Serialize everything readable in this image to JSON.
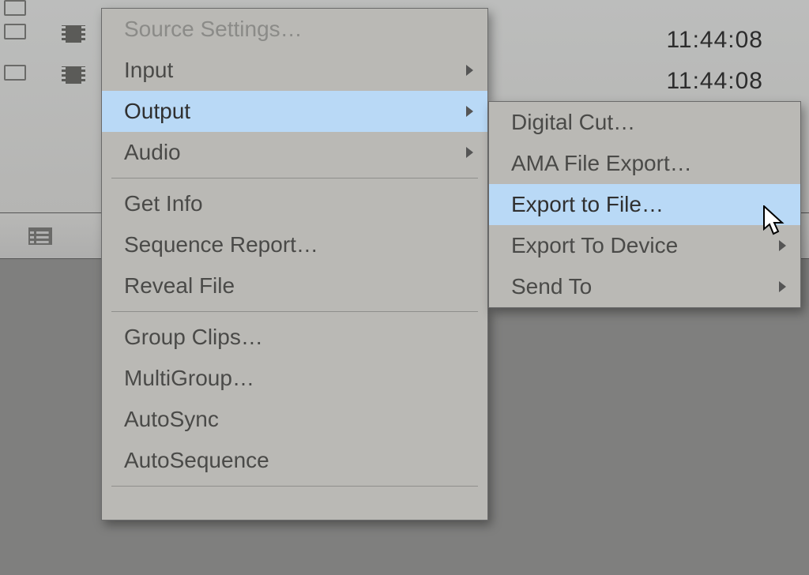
{
  "bin": {
    "timecodes": [
      "11:44:08",
      "11:44:08"
    ]
  },
  "context_menu": {
    "source_settings": "Source Settings…",
    "input": "Input",
    "output": "Output",
    "audio": "Audio",
    "get_info": "Get Info",
    "sequence_report": "Sequence Report…",
    "reveal_file": "Reveal File",
    "group_clips": "Group Clips…",
    "multigroup": "MultiGroup…",
    "autosync": "AutoSync",
    "autosequence": "AutoSequence"
  },
  "output_submenu": {
    "digital_cut": "Digital Cut…",
    "ama_file_export": "AMA File Export…",
    "export_to_file": "Export to File…",
    "export_to_device": "Export To Device",
    "send_to": "Send To"
  }
}
